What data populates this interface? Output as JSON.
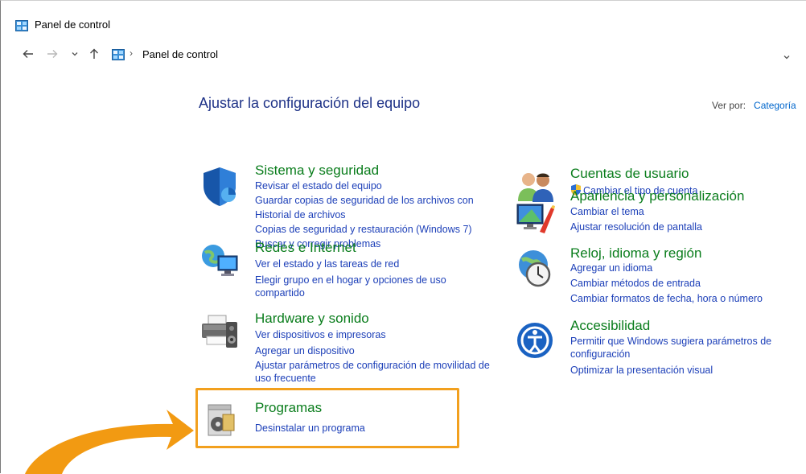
{
  "window": {
    "title": "Panel de control"
  },
  "address_bar": {
    "breadcrumb": "Panel de control",
    "separator": "›"
  },
  "main": {
    "heading": "Ajustar la configuración del equipo",
    "view_by_label": "Ver por:",
    "view_by_value": "Categoría"
  },
  "categories": {
    "sistema": {
      "title": "Sistema y seguridad",
      "links": [
        "Revisar el estado del equipo",
        "Guardar copias de seguridad de los archivos con",
        "Historial de archivos",
        "Copias de seguridad y restauración (Windows 7)",
        "Buscar y corregir problemas"
      ]
    },
    "redes": {
      "title": "Redes e Internet",
      "links": [
        "Ver el estado y las tareas de red",
        "Elegir grupo en el hogar y opciones de uso",
        "compartido"
      ]
    },
    "hardware": {
      "title": "Hardware y sonido",
      "links": [
        "Ver dispositivos e impresoras",
        "Agregar un dispositivo",
        "Ajustar parámetros de configuración de movilidad de",
        "uso frecuente"
      ]
    },
    "programas": {
      "title": "Programas",
      "links": [
        "Desinstalar un programa"
      ]
    },
    "cuentas": {
      "title": "Cuentas de usuario",
      "links": [
        "Cambiar el tipo de cuenta"
      ]
    },
    "apariencia": {
      "title": "Apariencia y personalización",
      "links": [
        "Cambiar el tema",
        "Ajustar resolución de pantalla"
      ]
    },
    "reloj": {
      "title": "Reloj, idioma y región",
      "links": [
        "Agregar un idioma",
        "Cambiar métodos de entrada",
        "Cambiar formatos de fecha, hora o número"
      ]
    },
    "accesibilidad": {
      "title": "Accesibilidad",
      "links": [
        "Permitir que Windows sugiera parámetros de",
        "configuración",
        "Optimizar la presentación visual"
      ]
    }
  },
  "colors": {
    "heading": "#1e3287",
    "category_title": "#0a7d1c",
    "link": "#1c3fb8",
    "highlight": "#f2a01e",
    "arrow": "#f29a12"
  },
  "icons": [
    "control-panel-icon",
    "back-arrow-icon",
    "forward-arrow-icon",
    "history-chevron-icon",
    "up-arrow-icon",
    "shield-icon",
    "network-icon",
    "printer-icon",
    "programs-icon",
    "users-icon",
    "appearance-icon",
    "clock-globe-icon",
    "accessibility-icon",
    "uac-shield-icon",
    "refresh-icon"
  ]
}
